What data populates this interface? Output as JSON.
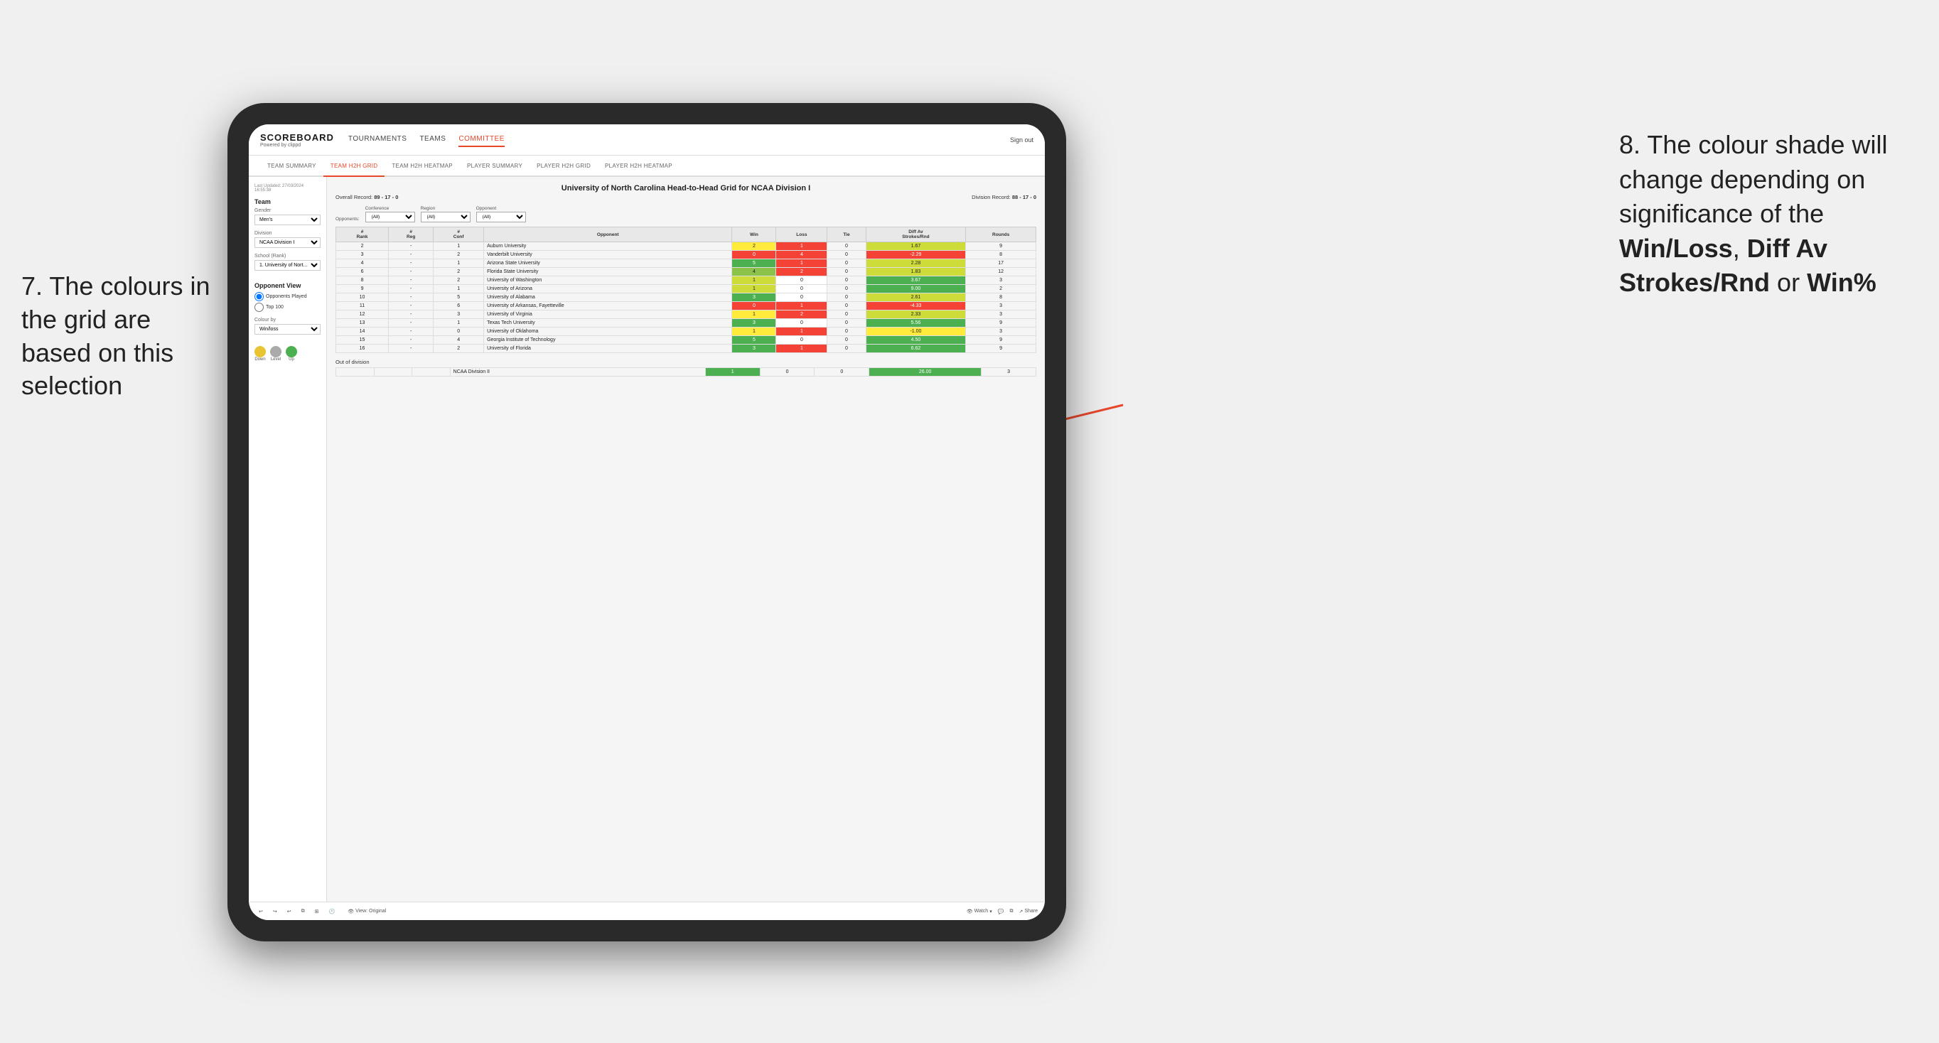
{
  "annotations": {
    "left": "7. The colours in the grid are based on this selection",
    "right_line1": "8. The colour shade will change depending on significance of the ",
    "right_bold1": "Win/Loss",
    "right_sep1": ", ",
    "right_bold2": "Diff Av Strokes/Rnd",
    "right_sep2": " or ",
    "right_bold3": "Win%"
  },
  "nav": {
    "logo": "SCOREBOARD",
    "logo_sub": "Powered by clippd",
    "links": [
      "TOURNAMENTS",
      "TEAMS",
      "COMMITTEE"
    ],
    "active_link": "COMMITTEE",
    "sign_out": "Sign out"
  },
  "sub_tabs": [
    {
      "label": "TEAM SUMMARY",
      "active": false
    },
    {
      "label": "TEAM H2H GRID",
      "active": true
    },
    {
      "label": "TEAM H2H HEATMAP",
      "active": false
    },
    {
      "label": "PLAYER SUMMARY",
      "active": false
    },
    {
      "label": "PLAYER H2H GRID",
      "active": false
    },
    {
      "label": "PLAYER H2H HEATMAP",
      "active": false
    }
  ],
  "sidebar": {
    "timestamp": "Last Updated: 27/03/2024 16:55:38",
    "team_label": "Team",
    "gender_label": "Gender",
    "gender_value": "Men's",
    "division_label": "Division",
    "division_value": "NCAA Division I",
    "school_label": "School (Rank)",
    "school_value": "1. University of Nort...",
    "opponent_view_label": "Opponent View",
    "opponent_view_options": [
      "Opponents Played",
      "Top 100"
    ],
    "colour_by_label": "Colour by",
    "colour_by_value": "Win/loss",
    "legend": [
      {
        "color": "#e8c432",
        "label": "Down"
      },
      {
        "color": "#aaaaaa",
        "label": "Level"
      },
      {
        "color": "#4caf50",
        "label": "Up"
      }
    ]
  },
  "grid": {
    "title": "University of North Carolina Head-to-Head Grid for NCAA Division I",
    "overall_record_label": "Overall Record:",
    "overall_record": "89 - 17 - 0",
    "division_record_label": "Division Record:",
    "division_record": "88 - 17 - 0",
    "filters": {
      "opponents_label": "Opponents:",
      "conference_label": "Conference",
      "conference_value": "(All)",
      "region_label": "Region",
      "region_value": "(All)",
      "opponent_label": "Opponent",
      "opponent_value": "(All)"
    },
    "columns": [
      "#\nRank",
      "#\nReg",
      "#\nConf",
      "Opponent",
      "Win",
      "Loss",
      "Tie",
      "Diff Av\nStrokes/Rnd",
      "Rounds"
    ],
    "rows": [
      {
        "rank": "2",
        "reg": "-",
        "conf": "1",
        "opponent": "Auburn University",
        "win": "2",
        "loss": "1",
        "tie": "0",
        "diff": "1.67",
        "rounds": "9",
        "win_color": "yellow",
        "diff_color": "green-light"
      },
      {
        "rank": "3",
        "reg": "-",
        "conf": "2",
        "opponent": "Vanderbilt University",
        "win": "0",
        "loss": "4",
        "tie": "0",
        "diff": "-2.29",
        "rounds": "8",
        "win_color": "red",
        "diff_color": "red"
      },
      {
        "rank": "4",
        "reg": "-",
        "conf": "1",
        "opponent": "Arizona State University",
        "win": "5",
        "loss": "1",
        "tie": "0",
        "diff": "2.28",
        "rounds": "17",
        "win_color": "green-dark",
        "diff_color": "green-light"
      },
      {
        "rank": "6",
        "reg": "-",
        "conf": "2",
        "opponent": "Florida State University",
        "win": "4",
        "loss": "2",
        "tie": "0",
        "diff": "1.83",
        "rounds": "12",
        "win_color": "green-med",
        "diff_color": "green-light"
      },
      {
        "rank": "8",
        "reg": "-",
        "conf": "2",
        "opponent": "University of Washington",
        "win": "1",
        "loss": "0",
        "tie": "0",
        "diff": "3.67",
        "rounds": "3",
        "win_color": "green-light",
        "diff_color": "green-dark"
      },
      {
        "rank": "9",
        "reg": "-",
        "conf": "1",
        "opponent": "University of Arizona",
        "win": "1",
        "loss": "0",
        "tie": "0",
        "diff": "9.00",
        "rounds": "2",
        "win_color": "green-light",
        "diff_color": "green-dark"
      },
      {
        "rank": "10",
        "reg": "-",
        "conf": "5",
        "opponent": "University of Alabama",
        "win": "3",
        "loss": "0",
        "tie": "0",
        "diff": "2.61",
        "rounds": "8",
        "win_color": "green-dark",
        "diff_color": "green-light"
      },
      {
        "rank": "11",
        "reg": "-",
        "conf": "6",
        "opponent": "University of Arkansas, Fayetteville",
        "win": "0",
        "loss": "1",
        "tie": "0",
        "diff": "-4.33",
        "rounds": "3",
        "win_color": "red",
        "diff_color": "red"
      },
      {
        "rank": "12",
        "reg": "-",
        "conf": "3",
        "opponent": "University of Virginia",
        "win": "1",
        "loss": "2",
        "tie": "0",
        "diff": "2.33",
        "rounds": "3",
        "win_color": "yellow",
        "diff_color": "green-light"
      },
      {
        "rank": "13",
        "reg": "-",
        "conf": "1",
        "opponent": "Texas Tech University",
        "win": "3",
        "loss": "0",
        "tie": "0",
        "diff": "5.56",
        "rounds": "9",
        "win_color": "green-dark",
        "diff_color": "green-dark"
      },
      {
        "rank": "14",
        "reg": "-",
        "conf": "0",
        "opponent": "University of Oklahoma",
        "win": "1",
        "loss": "1",
        "tie": "0",
        "diff": "-1.00",
        "rounds": "3",
        "win_color": "yellow",
        "diff_color": "yellow"
      },
      {
        "rank": "15",
        "reg": "-",
        "conf": "4",
        "opponent": "Georgia Institute of Technology",
        "win": "5",
        "loss": "0",
        "tie": "0",
        "diff": "4.50",
        "rounds": "9",
        "win_color": "green-dark",
        "diff_color": "green-dark"
      },
      {
        "rank": "16",
        "reg": "-",
        "conf": "2",
        "opponent": "University of Florida",
        "win": "3",
        "loss": "1",
        "tie": "0",
        "diff": "6.62",
        "rounds": "9",
        "win_color": "green-dark",
        "diff_color": "green-dark"
      }
    ],
    "out_of_division_label": "Out of division",
    "out_of_division_rows": [
      {
        "opponent": "NCAA Division II",
        "win": "1",
        "loss": "0",
        "tie": "0",
        "diff": "26.00",
        "rounds": "3",
        "win_color": "green-dark",
        "diff_color": "green-dark"
      }
    ]
  },
  "toolbar": {
    "view_label": "View: Original",
    "watch_label": "Watch",
    "share_label": "Share"
  }
}
